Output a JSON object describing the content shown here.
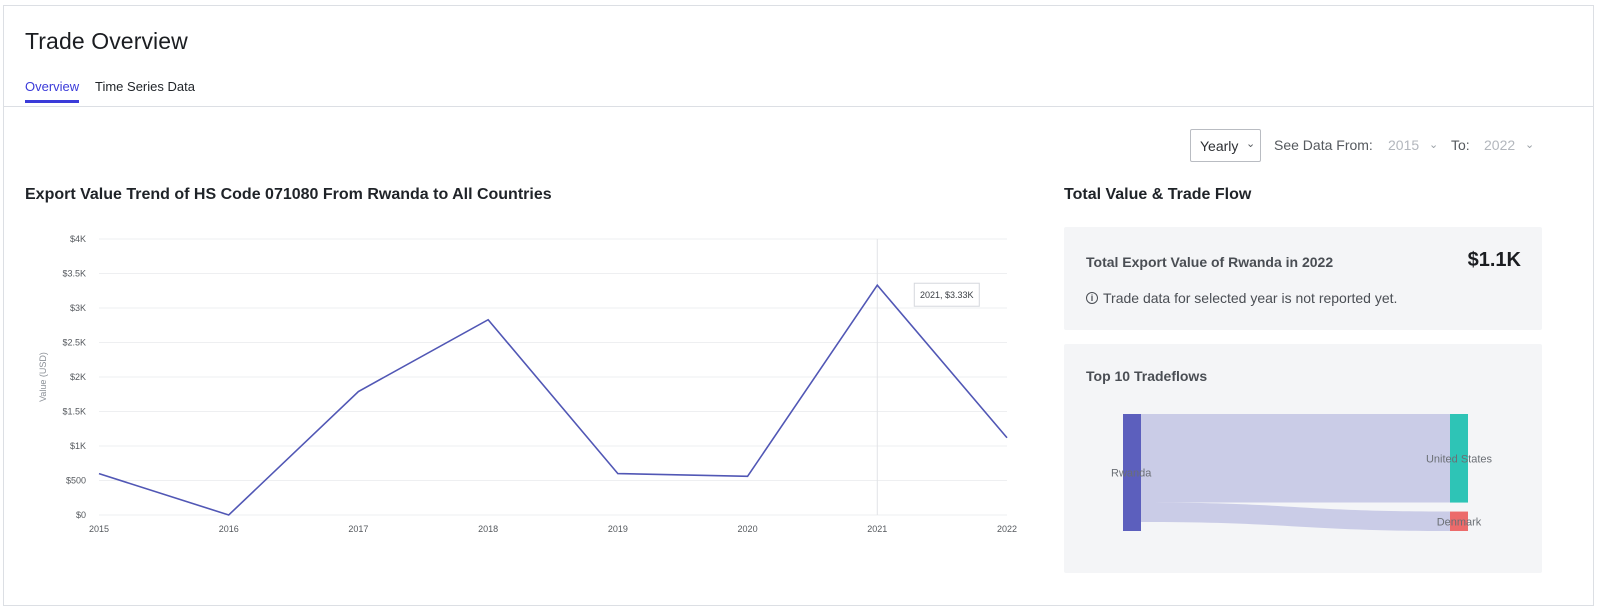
{
  "page": {
    "title": "Trade Overview"
  },
  "tabs": [
    {
      "label": "Overview",
      "active": true
    },
    {
      "label": "Time Series Data",
      "active": false
    }
  ],
  "controls": {
    "period": "Yearly",
    "see_data_label": "See Data From:",
    "from_year": "2015",
    "to_label": "To:",
    "to_year": "2022"
  },
  "chart_title": "Export Value Trend of HS Code 071080 From Rwanda to All Countries",
  "chart_data": {
    "type": "line",
    "ylabel": "Value (USD)",
    "x": [
      "2015",
      "2016",
      "2017",
      "2018",
      "2019",
      "2020",
      "2021",
      "2022"
    ],
    "series": [
      {
        "values": [
          600,
          0,
          1790,
          2830,
          600,
          560,
          3330,
          1120
        ]
      }
    ],
    "ylim": [
      0,
      4000
    ],
    "yticks": [
      0,
      500,
      1000,
      1500,
      2000,
      2500,
      3000,
      3500,
      4000
    ],
    "ytick_labels": [
      "$0",
      "$500",
      "$1K",
      "$1.5K",
      "$2K",
      "$2.5K",
      "$3K",
      "$3.5K",
      "$4K"
    ],
    "grid": true,
    "tooltip": {
      "x": "2021",
      "label": "2021, $3.33K"
    },
    "line_color": "#5157b5"
  },
  "trade_flow": {
    "title": "Total Value & Trade Flow",
    "total_label": "Total Export Value of Rwanda in 2022",
    "total_value": "$1.1K",
    "note": "Trade data for selected year is not reported yet.",
    "note_icon": "info-icon",
    "flows_title": "Top 10 Tradeflows",
    "sankey": {
      "source": {
        "name": "Rwanda",
        "color": "#5c5fbd"
      },
      "targets": [
        {
          "name": "United States",
          "share": 0.82,
          "color": "#2ec4b6"
        },
        {
          "name": "Denmark",
          "share": 0.18,
          "color": "#ec6b6b"
        }
      ],
      "link_color": "#c7c9e6"
    }
  }
}
